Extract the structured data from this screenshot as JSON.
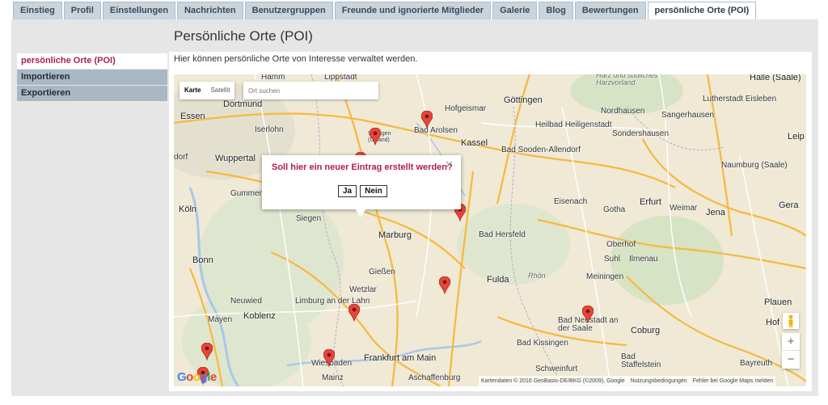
{
  "tabs": [
    "Einstieg",
    "Profil",
    "Einstellungen",
    "Nachrichten",
    "Benutzergruppen",
    "Freunde und ignorierte Mitglieder",
    "Galerie",
    "Blog",
    "Bewertungen",
    "persönliche Orte (POI)"
  ],
  "active_tab": "persönliche Orte (POI)",
  "page_title": "Persönliche Orte (POI)",
  "sidebar": {
    "items": [
      {
        "label": "persönliche Orte (POI)",
        "active": true
      },
      {
        "label": "Importieren",
        "active": false
      },
      {
        "label": "Exportieren",
        "active": false
      }
    ]
  },
  "intro_text": "Hier können persönliche Orte von Interesse verwaltet werden.",
  "map": {
    "type_buttons": {
      "map": "Karte",
      "satellite": "Satellit"
    },
    "search_placeholder": "Ort suchen",
    "places": {
      "hamm": "Hamm",
      "lippstadt": "Lippstadt",
      "dortmund": "Dortmund",
      "essen": "Essen",
      "wuppertal": "Wuppertal",
      "iserlohn": "Iserlohn",
      "gummersbach": "Gummer",
      "koeln": "Köln",
      "bonn": "Bonn",
      "siegen": "Siegen",
      "marburg": "Marburg",
      "giessen": "Gießen",
      "wetzlar": "Wetzlar",
      "limburg": "Limburg an der Lahn",
      "koblenz": "Koblenz",
      "neuwied": "Neuwied",
      "mayen": "Mayen",
      "frankfurt": "Frankfurt am Main",
      "wiesbaden": "Wiesbaden",
      "mainz": "Mainz",
      "aschaffenburg": "Aschaffenburg",
      "fulda": "Fulda",
      "bad_hersfeld": "Bad Hersfeld",
      "kassel": "Kassel",
      "bad_arolsen": "Bad Arolsen",
      "hofgeismar": "Hofgeismar",
      "goettingen": "Göttingen",
      "heilbad": "Heilbad Heiligenstadt",
      "eisenach": "Eisenach",
      "gotha": "Gotha",
      "erfurt": "Erfurt",
      "weimar": "Weimar",
      "jena": "Jena",
      "nordhausen": "Nordhausen",
      "sondershausen": "Sondershausen",
      "sangerhausen": "Sangerhausen",
      "lutherstadt": "Lutherstadt Eisleben",
      "halle": "Halle (Saale)",
      "naumburg": "Naumburg (Saale)",
      "suhl": "Suhl",
      "ilmenau": "Ilmenau",
      "meiningen": "Meiningen",
      "oberhof": "Oberhof",
      "plauen": "Plauen",
      "hof": "Hof",
      "coburg": "Coburg",
      "bad_kissingen": "Bad Kissingen",
      "bad_neustadt": "Bad Neustadt an der Saale",
      "schweinfurt": "Schweinfurt",
      "bad_staffelstein": "Bad Staffelstein",
      "bayreuth": "Bayreuth",
      "rhoen": "Rhön",
      "harz": "Harz und südliches Harzvorland",
      "bad_sooden": "Bad Sooden-Allendorf",
      "leipzig": "Leip",
      "gera": "Gera",
      "wildungen": "Willingen (Upland)",
      "dorf": "dorf"
    },
    "attribution": {
      "data": "Kartendaten © 2016 GeoBasis-DE/BKG (©2009), Google",
      "terms": "Nutzungsbedingungen",
      "report": "Fehler bei Google Maps melden"
    },
    "logo": "Google",
    "popup": {
      "question": "Soll hier ein neuer Eintrag erstellt werden?",
      "yes": "Ja",
      "no": "Nein"
    }
  }
}
